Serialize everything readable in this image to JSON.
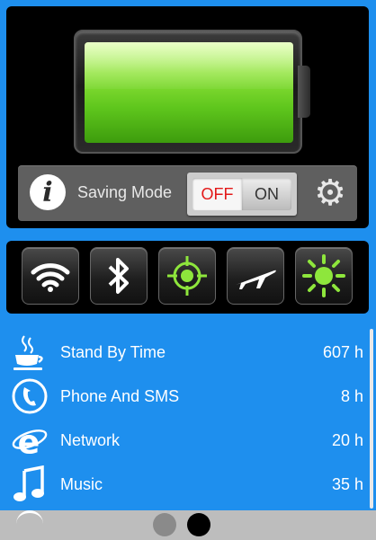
{
  "battery": {
    "level_fraction": 1.0,
    "fill_color": "#6cd22a"
  },
  "saving_mode": {
    "label": "Saving Mode",
    "off_label": "OFF",
    "on_label": "ON",
    "state": "off",
    "info_icon": "info-icon",
    "settings_icon": "gear-icon"
  },
  "toggles": [
    {
      "name": "wifi",
      "icon": "wifi-icon",
      "active": false
    },
    {
      "name": "bluetooth",
      "icon": "bluetooth-icon",
      "active": false
    },
    {
      "name": "gps",
      "icon": "gps-icon",
      "active": true
    },
    {
      "name": "airplane",
      "icon": "airplane-icon",
      "active": false
    },
    {
      "name": "brightness",
      "icon": "brightness-icon",
      "active": true
    }
  ],
  "usage": [
    {
      "icon": "coffee-cup-icon",
      "label": "Stand By Time",
      "value": "607 h"
    },
    {
      "icon": "phone-icon",
      "label": "Phone And SMS",
      "value": "8 h"
    },
    {
      "icon": "network-e-icon",
      "label": "Network",
      "value": "20 h"
    },
    {
      "icon": "music-note-icon",
      "label": "Music",
      "value": "35 h"
    }
  ],
  "pager": {
    "pages": 2,
    "current": 2
  },
  "colors": {
    "background": "#1e8fee",
    "accent_green": "#7fe53a",
    "off_red": "#e31919"
  }
}
